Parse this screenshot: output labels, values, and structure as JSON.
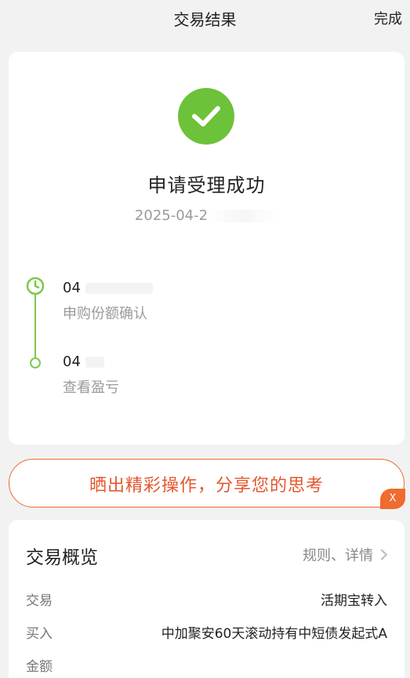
{
  "header": {
    "title": "交易结果",
    "done_label": "完成"
  },
  "result": {
    "status_title": "申请受理成功",
    "status_time": "2025-04-2",
    "colors": {
      "success": "#6cc238",
      "timeline": "#7cc94a"
    },
    "timeline": [
      {
        "date": "04",
        "desc": "申购份额确认",
        "icon": "clock-icon"
      },
      {
        "date": "04",
        "desc": "查看盈亏",
        "icon": "dot-icon"
      }
    ]
  },
  "share_banner": {
    "label": "晒出精彩操作，分享您的思考",
    "close_label": "X",
    "accent": "#ef6b2f"
  },
  "overview": {
    "title": "交易概览",
    "link_label": "规则、详情",
    "rows": [
      {
        "key": "交易",
        "value": "活期宝转入"
      },
      {
        "key": "买入",
        "value": "中加聚安60天滚动持有中短债发起式A"
      },
      {
        "key": "金额",
        "value": ""
      }
    ]
  }
}
